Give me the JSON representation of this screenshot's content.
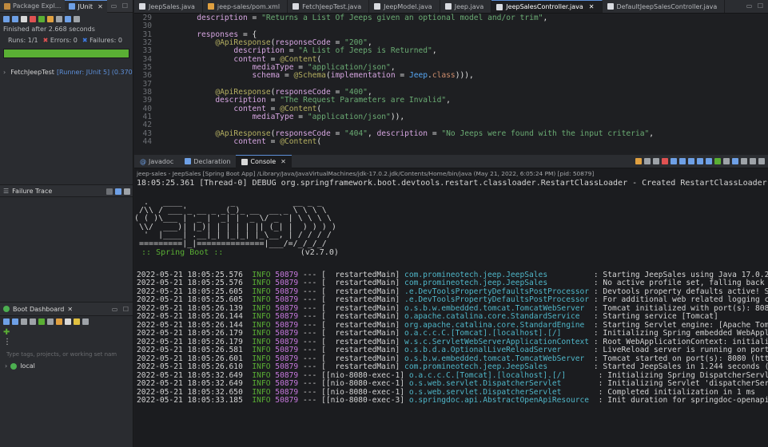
{
  "left": {
    "top_tabs": [
      {
        "label": "Package Expl...",
        "active": false
      },
      {
        "label": "JUnit",
        "active": true
      }
    ],
    "junit": {
      "status": "Finished after 2.668 seconds",
      "runs_label": "Runs:",
      "runs_value": "1/1",
      "errors_label": "Errors:",
      "errors_value": "0",
      "failures_label": "Failures:",
      "failures_value": "0",
      "progress": 1.0,
      "test_item": "FetchJeepTest",
      "test_item_meta": "[Runner: JUnit 5] (0.370"
    },
    "failure_trace": {
      "title": "Failure Trace"
    },
    "boot_dashboard": {
      "title": "Boot Dashboard",
      "search_placeholder": "Type tags, projects, or working set nam",
      "item": "local"
    }
  },
  "editor": {
    "tabs": [
      {
        "label": "JeepSales.java",
        "active": false,
        "icon": "java-file-icon"
      },
      {
        "label": "jeep-sales/pom.xml",
        "active": false,
        "icon": "xml-file-icon"
      },
      {
        "label": "FetchJeepTest.java",
        "active": false,
        "icon": "java-file-icon"
      },
      {
        "label": "JeepModel.java",
        "active": false,
        "icon": "java-file-icon"
      },
      {
        "label": "Jeep.java",
        "active": false,
        "icon": "java-file-icon"
      },
      {
        "label": "JeepSalesController.java",
        "active": true,
        "icon": "java-file-icon"
      },
      {
        "label": "DefaultJeepSalesController.java",
        "active": false,
        "icon": "java-file-icon"
      }
    ],
    "lines": [
      {
        "n": "29",
        "code": "        description = \"Returns a List Of Jeeps given an optional model and/or trim\","
      },
      {
        "n": "30",
        "code": ""
      },
      {
        "n": "31",
        "code": "        responses = {"
      },
      {
        "n": "32",
        "code": "            @ApiResponse(responseCode = \"200\","
      },
      {
        "n": "33",
        "code": "                description = \"A List of Jeeps is Returned\","
      },
      {
        "n": "34",
        "code": "                content = @Content("
      },
      {
        "n": "35",
        "code": "                    mediaType = \"application/json\","
      },
      {
        "n": "36",
        "code": "                    schema = @Schema(implementation = Jeep.class))),"
      },
      {
        "n": "37",
        "code": ""
      },
      {
        "n": "38",
        "code": "            @ApiResponse(responseCode = \"400\","
      },
      {
        "n": "39",
        "code": "            description = \"The Request Parameters are Invalid\","
      },
      {
        "n": "40",
        "code": "                content = @Content("
      },
      {
        "n": "41",
        "code": "                    mediaType = \"application/json\")),"
      },
      {
        "n": "42",
        "code": ""
      },
      {
        "n": "43",
        "code": "            @ApiResponse(responseCode = \"404\", description = \"No Jeeps were found with the input criteria\","
      },
      {
        "n": "44",
        "code": "                content = @Content("
      }
    ]
  },
  "console": {
    "tabs": [
      {
        "label": "Javadoc",
        "active": false
      },
      {
        "label": "Declaration",
        "active": false
      },
      {
        "label": "Console",
        "active": true
      }
    ],
    "process": "jeep-sales - JeepSales [Spring Boot App] /Library/Java/JavaVirtualMachines/jdk-17.0.2.jdk/Contents/Home/bin/java  (May 21, 2022, 6:05:24 PM) [pid: 50879]",
    "first_line": "18:05:25.361 [Thread-0] DEBUG org.springframework.boot.devtools.restart.classloader.RestartClassLoader - Created RestartClassLoader org.spri",
    "banner": [
      "  .   ____          _            __ _ _",
      " /\\\\ / ___'_ __ _ _(_)_ __  __ _ \\ \\ \\ \\",
      "( ( )\\___ | '_ | '_| | '_ \\/ _` | \\ \\ \\ \\",
      " \\\\/  ___)| |_)| | | | | || (_| |  ) ) ) )",
      "  '  |____| .__|_| |_|_| |_\\__, | / / / /",
      " =========|_|==============|___/=/_/_/_/"
    ],
    "boot_label": " :: Spring Boot :: ",
    "boot_version": "               (v2.7.0)",
    "logs": [
      {
        "ts": "2022-05-21 18:05:25.576",
        "thread": "  restartedMain]",
        "logger": "com.promineotech.jeep.JeepSales",
        "msg": ": Starting JeepSales using Java 17.0.2 on"
      },
      {
        "ts": "2022-05-21 18:05:25.576",
        "thread": "  restartedMain]",
        "logger": "com.promineotech.jeep.JeepSales",
        "msg": ": No active profile set, falling back to"
      },
      {
        "ts": "2022-05-21 18:05:25.605",
        "thread": "  restartedMain]",
        "logger": ".e.DevToolsPropertyDefaultsPostProcessor",
        "msg": ": Devtools property defaults active! Set"
      },
      {
        "ts": "2022-05-21 18:05:25.605",
        "thread": "  restartedMain]",
        "logger": ".e.DevToolsPropertyDefaultsPostProcessor",
        "msg": ": For additional web related logging cons"
      },
      {
        "ts": "2022-05-21 18:05:26.139",
        "thread": "  restartedMain]",
        "logger": "o.s.b.w.embedded.tomcat.TomcatWebServer",
        "msg": ": Tomcat initialized with port(s): 8080 ("
      },
      {
        "ts": "2022-05-21 18:05:26.144",
        "thread": "  restartedMain]",
        "logger": "o.apache.catalina.core.StandardService",
        "msg": ": Starting service [Tomcat]"
      },
      {
        "ts": "2022-05-21 18:05:26.144",
        "thread": "  restartedMain]",
        "logger": "org.apache.catalina.core.StandardEngine",
        "msg": ": Starting Servlet engine: [Apache Tomcat"
      },
      {
        "ts": "2022-05-21 18:05:26.179",
        "thread": "  restartedMain]",
        "logger": "o.a.c.c.C.[Tomcat].[localhost].[/]",
        "msg": ": Initializing Spring embedded WebApplica"
      },
      {
        "ts": "2022-05-21 18:05:26.179",
        "thread": "  restartedMain]",
        "logger": "w.s.c.ServletWebServerApplicationContext",
        "msg": ": Root WebApplicationContext: initializat"
      },
      {
        "ts": "2022-05-21 18:05:26.581",
        "thread": "  restartedMain]",
        "logger": "o.s.b.d.a.OptionalLiveReloadServer",
        "msg": ": LiveReload server is running on port 35"
      },
      {
        "ts": "2022-05-21 18:05:26.601",
        "thread": "  restartedMain]",
        "logger": "o.s.b.w.embedded.tomcat.TomcatWebServer",
        "msg": ": Tomcat started on port(s): 8080 (http)"
      },
      {
        "ts": "2022-05-21 18:05:26.610",
        "thread": "  restartedMain]",
        "logger": "com.promineotech.jeep.JeepSales",
        "msg": ": Started JeepSales in 1.244 seconds (JVM"
      },
      {
        "ts": "2022-05-21 18:05:32.649",
        "thread": "[nio-8080-exec-1]",
        "logger": "o.a.c.c.C.[Tomcat].[localhost].[/]",
        "msg": ": Initializing Spring DispatcherServlet '"
      },
      {
        "ts": "2022-05-21 18:05:32.649",
        "thread": "[nio-8080-exec-1]",
        "logger": "o.s.web.servlet.DispatcherServlet",
        "msg": ": Initializing Servlet 'dispatcherServlet"
      },
      {
        "ts": "2022-05-21 18:05:32.650",
        "thread": "[nio-8080-exec-1]",
        "logger": "o.s.web.servlet.DispatcherServlet",
        "msg": ": Completed initialization in 1 ms"
      },
      {
        "ts": "2022-05-21 18:05:33.185",
        "thread": "[nio-8080-exec-3]",
        "logger": "o.springdoc.api.AbstractOpenApiResource",
        "msg": ": Init duration for springdoc-openapi is:"
      }
    ],
    "log_level": "INFO",
    "log_pid": "50879",
    "log_dashes": "---"
  },
  "colors": {
    "progress_green": "#5aaf34",
    "accent_blue": "#5d8fd8"
  }
}
